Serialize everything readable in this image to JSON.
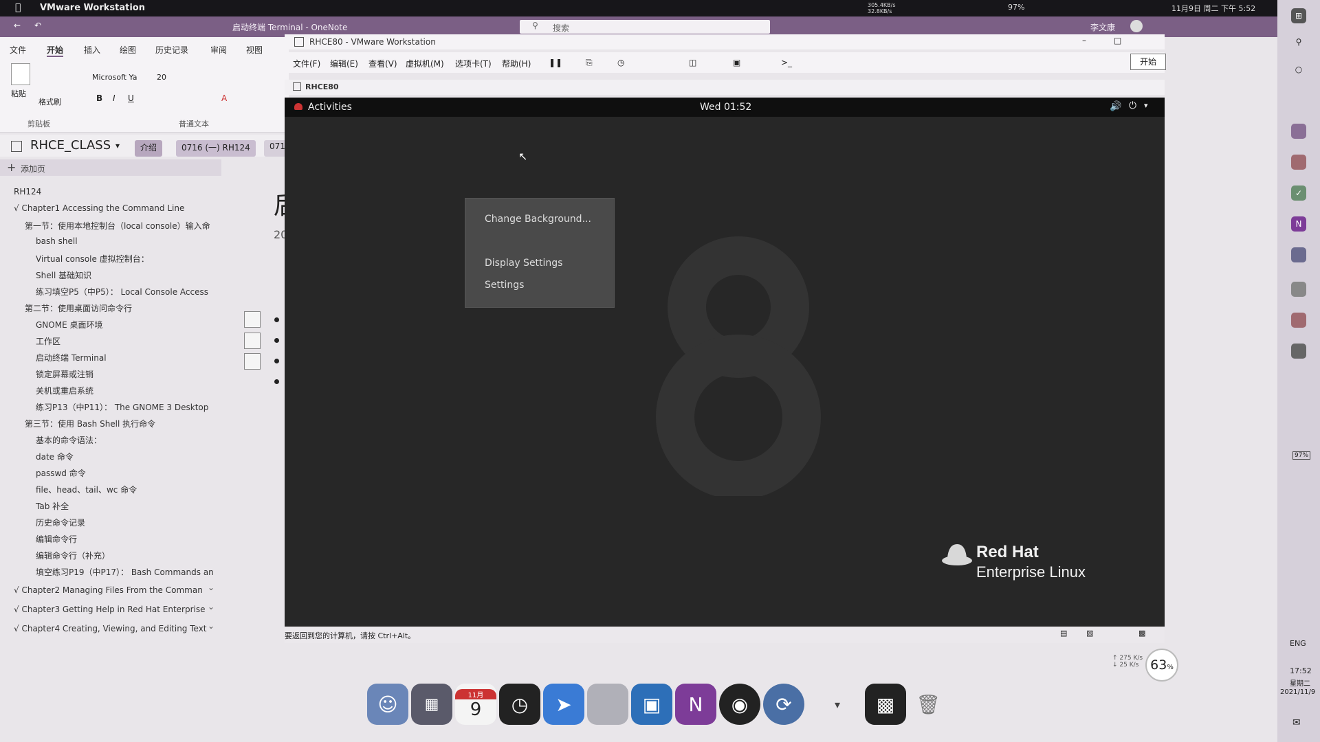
{
  "mac_bar": {
    "app_name": "VMware Workstation",
    "net_up": "305.4KB/s",
    "net_down": "32.8KB/s",
    "battery": "97%",
    "datetime": "11月9日 周二 下午 5:52",
    "user": "李文康"
  },
  "onenote": {
    "title": "启动终端 Terminal - OneNote",
    "search_placeholder": "搜索",
    "tabs": [
      "文件",
      "开始",
      "插入",
      "绘图",
      "历史记录",
      "审阅",
      "视图"
    ],
    "ribbon": {
      "paste": "粘贴",
      "format_painter": "格式刷",
      "font": "Microsoft Ya",
      "size": "20",
      "clipboard_group": "剪贴板",
      "text_group": "普通文本"
    },
    "notebook": "RHCE_CLASS",
    "sections": [
      "介绍",
      "0716 (一) RH124",
      "071"
    ],
    "add_page": "添加页",
    "page_title_partial": "后",
    "page_date_partial": "20",
    "pages": [
      {
        "text": "RH124",
        "indent": 0
      },
      {
        "text": "√ Chapter1 Accessing the Command Line",
        "indent": 0
      },
      {
        "text": "第一节：使用本地控制台（local console）输入命",
        "indent": 1
      },
      {
        "text": "bash shell",
        "indent": 2
      },
      {
        "text": "Virtual console 虚拟控制台：",
        "indent": 2
      },
      {
        "text": "Shell 基础知识",
        "indent": 2
      },
      {
        "text": "练习填空P5（中P5）：  Local Console Access",
        "indent": 2
      },
      {
        "text": "第二节：使用桌面访问命令行",
        "indent": 1
      },
      {
        "text": "GNOME 桌面环境",
        "indent": 2
      },
      {
        "text": "工作区",
        "indent": 2
      },
      {
        "text": "启动终端 Terminal",
        "indent": 2
      },
      {
        "text": "锁定屏幕或注销",
        "indent": 2
      },
      {
        "text": "关机或重启系统",
        "indent": 2
      },
      {
        "text": "练习P13（中P11）：  The GNOME 3 Desktop",
        "indent": 2
      },
      {
        "text": "第三节：使用 Bash Shell 执行命令",
        "indent": 1
      },
      {
        "text": "基本的命令语法：",
        "indent": 2
      },
      {
        "text": "date 命令",
        "indent": 2
      },
      {
        "text": "passwd 命令",
        "indent": 2
      },
      {
        "text": "file、head、tail、wc 命令",
        "indent": 2
      },
      {
        "text": "Tab 补全",
        "indent": 2
      },
      {
        "text": "历史命令记录",
        "indent": 2
      },
      {
        "text": "编辑命令行",
        "indent": 2
      },
      {
        "text": "编辑命令行（补充）",
        "indent": 2
      },
      {
        "text": "填空练习P19（中P17）：  Bash Commands an",
        "indent": 2
      }
    ],
    "chapters_collapsed": [
      "√ Chapter2 Managing Files From the Comman",
      "√ Chapter3 Getting Help in Red Hat Enterprise",
      "√ Chapter4 Creating, Viewing, and Editing Text"
    ]
  },
  "vmware": {
    "title": "RHCE80 - VMware Workstation",
    "menu": [
      "文件(F)",
      "编辑(E)",
      "查看(V)",
      "虚拟机(M)",
      "选项卡(T)",
      "帮助(H)"
    ],
    "start_button": "开始",
    "vm_tab": "RHCE80",
    "status_text": "要返回到您的计算机，请按 Ctrl+Alt。"
  },
  "guest": {
    "activities": "Activities",
    "clock": "Wed 01:52",
    "context_menu": [
      "Change Background...",
      "Display Settings",
      "Settings"
    ],
    "logo_line1": "Red Hat",
    "logo_line2": "Enterprise Linux"
  },
  "right_side": {
    "battery": "97%",
    "lang": "ENG",
    "time": "17:52",
    "date_partial": "星期二",
    "date2": "2021/11/9"
  },
  "widgets": {
    "net_up": "↑ 275 K/s",
    "net_down": "↓ 25 K/s",
    "cpu_pct": "63",
    "cpu_unit": "%"
  },
  "dock": {
    "calendar_month": "11月",
    "calendar_day": "9",
    "onenote_letter": "N"
  }
}
